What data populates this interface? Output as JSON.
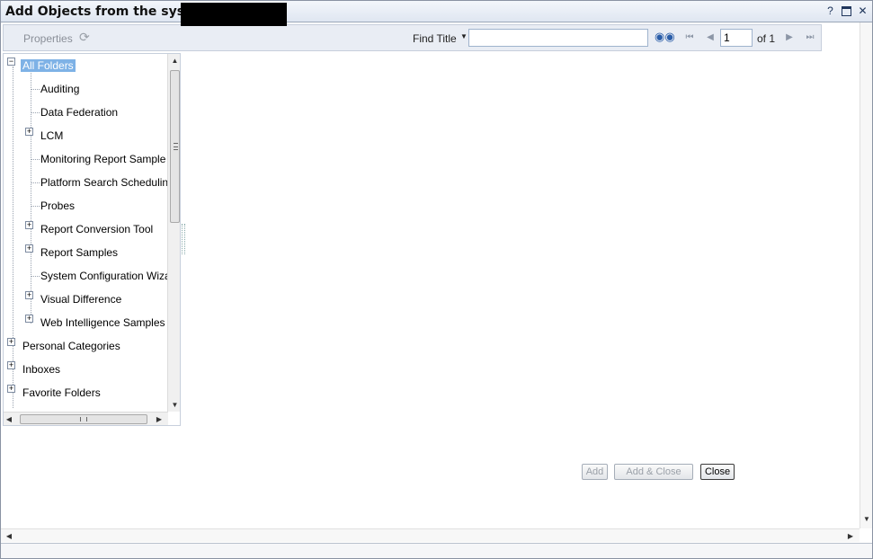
{
  "window": {
    "title": "Add Objects from the system:",
    "help_label": "?",
    "close_label": "✕"
  },
  "toolbar": {
    "properties_label": "Properties",
    "find_title_label": "Find Title",
    "search_value": "",
    "page_value": "1",
    "page_of_label": "of 1"
  },
  "tree": {
    "root": {
      "label": "All Folders",
      "expanded": true,
      "selected": true
    },
    "children": [
      {
        "label": "Auditing",
        "has_children": false
      },
      {
        "label": "Data Federation",
        "has_children": false
      },
      {
        "label": "LCM",
        "has_children": true
      },
      {
        "label": "Monitoring Report Sample",
        "has_children": false
      },
      {
        "label": "Platform Search Scheduling",
        "has_children": false
      },
      {
        "label": "Probes",
        "has_children": false
      },
      {
        "label": "Report Conversion Tool",
        "has_children": true
      },
      {
        "label": "Report Samples",
        "has_children": true
      },
      {
        "label": "System Configuration Wizard",
        "has_children": false
      },
      {
        "label": "Visual Difference",
        "has_children": true
      },
      {
        "label": "Web Intelligence Samples",
        "has_children": true
      }
    ],
    "top_level": [
      {
        "label": "Personal Categories",
        "has_children": true
      },
      {
        "label": "Inboxes",
        "has_children": true
      },
      {
        "label": "Favorite Folders",
        "has_children": true
      }
    ]
  },
  "buttons": {
    "add_label": "Add",
    "add_close_label": "Add & Close",
    "close_label": "Close"
  },
  "colors": {
    "selection": "#7eb2e6",
    "toolbar_bg": "#e9edf4",
    "titlebar_bg": "#dfe6f1"
  },
  "icons": [
    "refresh-icon",
    "binoculars-icon",
    "first-page-icon",
    "prev-page-icon",
    "next-page-icon",
    "last-page-icon",
    "help-icon",
    "maximize-icon",
    "close-icon"
  ]
}
